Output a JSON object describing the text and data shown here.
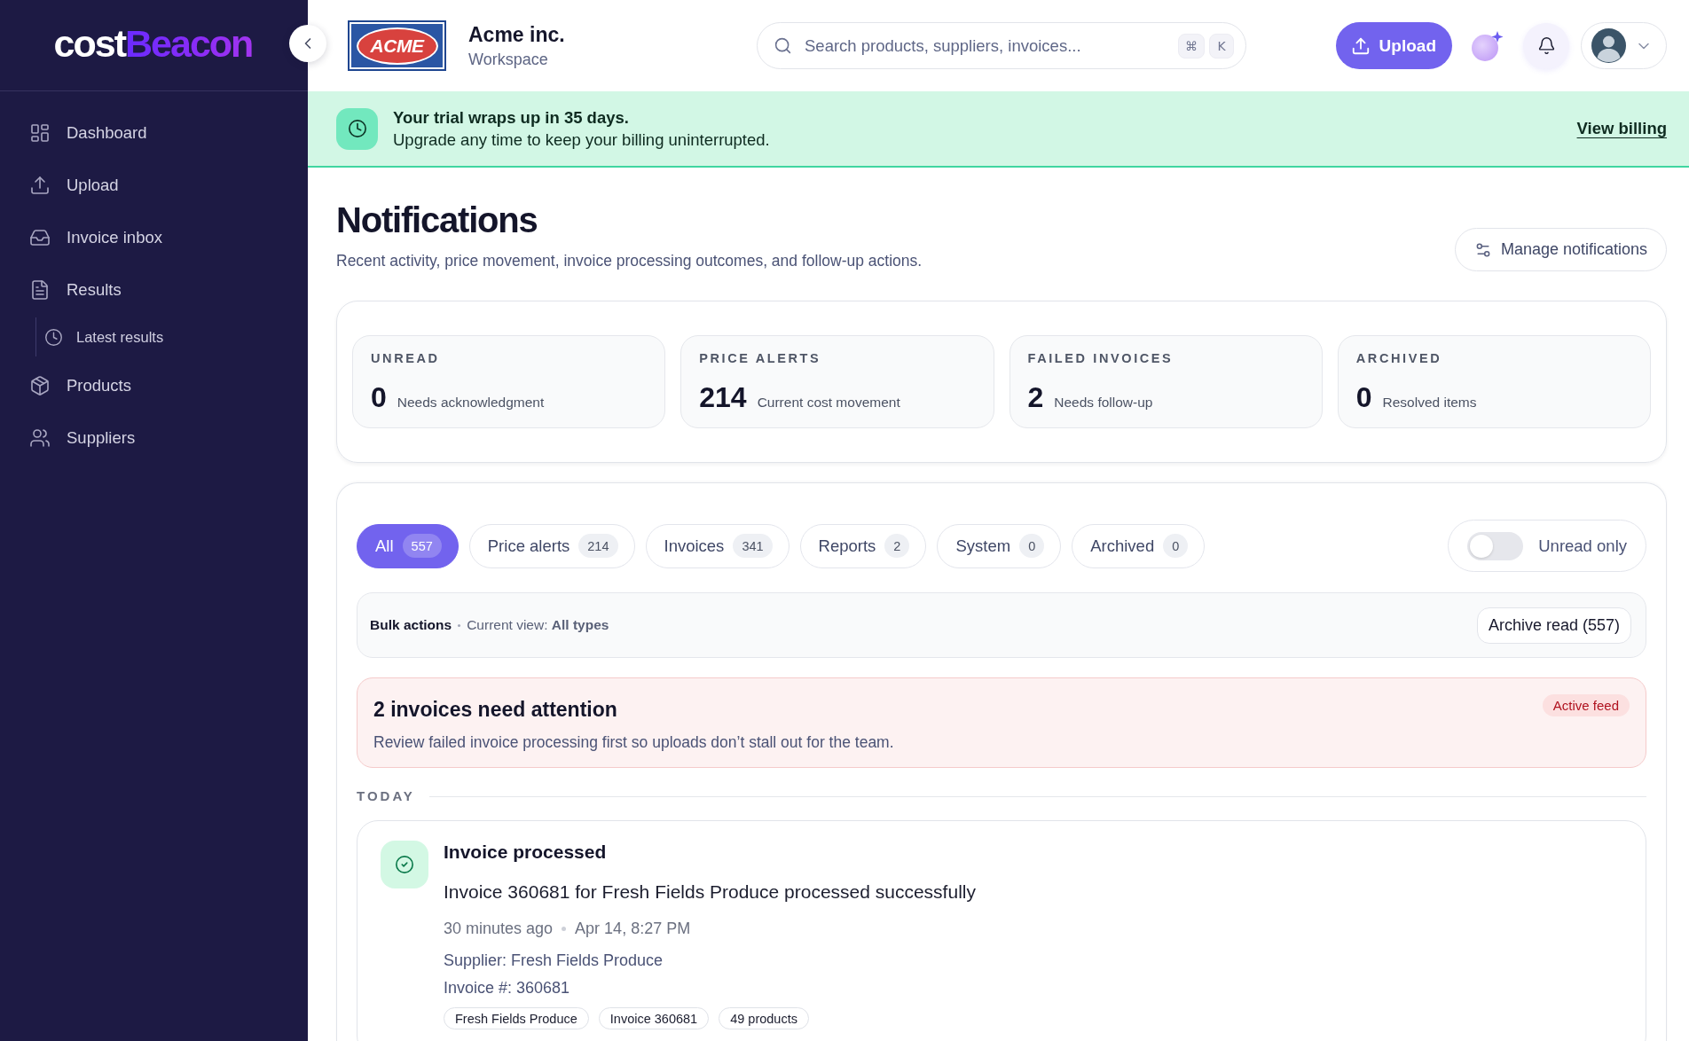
{
  "sidebar": {
    "logo": {
      "prefix": "cost",
      "name": "Beacon"
    },
    "items": [
      {
        "label": "Dashboard",
        "selected": false
      },
      {
        "label": "Upload",
        "selected": false
      },
      {
        "label": "Invoice inbox",
        "selected": false
      },
      {
        "label": "Results",
        "selected": false,
        "children": [
          {
            "label": "Latest results",
            "selected": false
          }
        ]
      },
      {
        "label": "Products",
        "selected": false
      },
      {
        "label": "Suppliers",
        "selected": false
      }
    ]
  },
  "header": {
    "company": {
      "logo_text": "ACME",
      "name": "Acme inc.",
      "subtitle": "Workspace"
    },
    "search": {
      "placeholder": "Search products, suppliers, invoices...",
      "shortcut": [
        "⌘",
        "K"
      ]
    },
    "upload_button": "Upload"
  },
  "trial_banner": {
    "title": "Your trial wraps up in 35 days.",
    "message": "Upgrade any time to keep your billing uninterrupted.",
    "link": "View billing"
  },
  "page": {
    "title": "Notifications",
    "subtitle": "Recent activity, price movement, invoice processing outcomes, and follow-up actions.",
    "manage_button": "Manage notifications"
  },
  "stats": [
    {
      "label": "UNREAD",
      "value": "0",
      "note": "Needs acknowledgment"
    },
    {
      "label": "PRICE ALERTS",
      "value": "214",
      "note": "Current cost movement"
    },
    {
      "label": "FAILED INVOICES",
      "value": "2",
      "note": "Needs follow-up"
    },
    {
      "label": "ARCHIVED",
      "value": "0",
      "note": "Resolved items"
    }
  ],
  "feed": {
    "tabs": [
      {
        "label": "All",
        "count": "557",
        "selected": true
      },
      {
        "label": "Price alerts",
        "count": "214",
        "selected": false
      },
      {
        "label": "Invoices",
        "count": "341",
        "selected": false
      },
      {
        "label": "Reports",
        "count": "2",
        "selected": false
      },
      {
        "label": "System",
        "count": "0",
        "selected": false
      },
      {
        "label": "Archived",
        "count": "0",
        "selected": false
      }
    ],
    "unread_toggle": {
      "label": "Unread only",
      "on": false
    },
    "bulk_actions": {
      "title": "Bulk actions",
      "current_view": "Current view: **All types**",
      "button": "Archive read (557)"
    },
    "attention": {
      "title": "2 invoices need attention",
      "message": "Review failed invoice processing first so uploads don’t stall out for the team.",
      "badge": "Active feed"
    },
    "sections": [
      {
        "heading": "TODAY",
        "notifications": [
          {
            "kind": "success",
            "title": "Invoice processed",
            "message": "Invoice 360681 for Fresh Fields Produce processed successfully",
            "time": "30 minutes ago",
            "date": "Apr 14, 8:27 PM",
            "details": [
              "Supplier: Fresh Fields Produce",
              "Invoice #: 360681"
            ],
            "tags": [
              "Fresh Fields Produce",
              "Invoice 360681",
              "49 products"
            ]
          }
        ]
      }
    ]
  }
}
